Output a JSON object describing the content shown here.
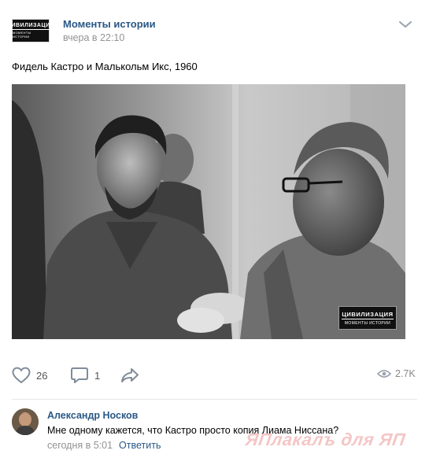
{
  "post": {
    "group_logo": {
      "line1": "ЦИВИЛИЗАЦИЯ",
      "line2": "МОМЕНТЫ ИСТОРИИ"
    },
    "group_name": "Моменты истории",
    "time": "вчера в 22:10",
    "text": "Фидель Кастро и Малькольм Икс, 1960",
    "photo_watermark": {
      "line1": "ЦИВИЛИЗАЦИЯ",
      "line2": "МОМЕНТЫ ИСТОРИИ"
    }
  },
  "actions": {
    "likes": "26",
    "comments": "1",
    "views": "2.7K",
    "icons": [
      "heart-icon",
      "comment-icon",
      "share-icon",
      "eye-icon",
      "chevron-down-icon"
    ]
  },
  "comment": {
    "author": "Александр Носков",
    "text": "Мне одному кажется, что Кастро просто копия Лиама Ниссана?",
    "time": "сегодня в 5:01",
    "reply_label": "Ответить"
  },
  "site_watermark": "ЯПлакалъ для ЯП",
  "colors": {
    "link": "#2a5885",
    "meta": "#939393",
    "icon": "#818c99"
  }
}
